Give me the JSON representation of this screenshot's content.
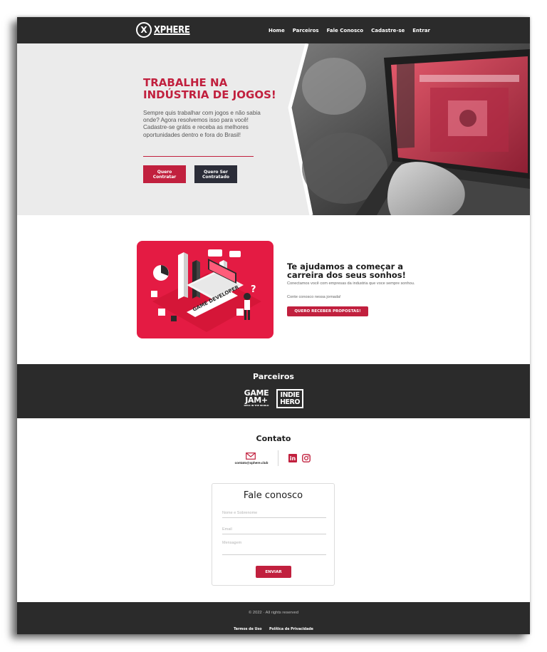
{
  "nav": {
    "logo_mark": "X",
    "logo_text": "XPHERE",
    "items": [
      "Home",
      "Parceiros",
      "Fale Conosco",
      "Cadastre-se",
      "Entrar"
    ]
  },
  "hero": {
    "title_line1": "TRABALHE NA",
    "title_line2": "INDÚSTRIA DE JOGOS!",
    "text": "Sempre quis trabalhar com jogos e não sabia onde? Agora resolvemos isso para você! Cadastre-se grátis e receba as melhores oportunidades dentro e fora do Brasil!",
    "btn_hire_line1": "Quero",
    "btn_hire_line2": "Contratar",
    "btn_hired_line1": "Quero Ser",
    "btn_hired_line2": "Contratado"
  },
  "about": {
    "title": "Te ajudamos a começar a carreira dos seus sonhos!",
    "text1": "Conectamos você com empresas da industria que voce sempre sonhou.",
    "text2": "Conte conosco nessa jornada!",
    "button": "QUERO RECEBER PROPOSTAS!",
    "illustration_label": "GAME DEVELOPER"
  },
  "partners": {
    "title": "Parceiros",
    "gamejam_line1": "GAME",
    "gamejam_line2": "JAM+",
    "gamejam_tagline": "DEVS IN THE WORLD",
    "indiehero_line1": "INDIE",
    "indiehero_line2": "HERO"
  },
  "contact": {
    "title": "Contato",
    "email": "contato@xphere.club",
    "linkedin_glyph": "in"
  },
  "form": {
    "title": "Fale conosco",
    "name_placeholder": "Nome e Sobrenome",
    "email_placeholder": "Email",
    "message_placeholder": "Mensagem",
    "send": "ENVIAR"
  },
  "footer": {
    "copyright": "© 2022 · All rights reserved",
    "terms": "Termos de Uso",
    "privacy": "Política de Privacidade"
  },
  "colors": {
    "accent": "#c1203e",
    "dark": "#2b2b2b",
    "card": "#e41b43"
  }
}
